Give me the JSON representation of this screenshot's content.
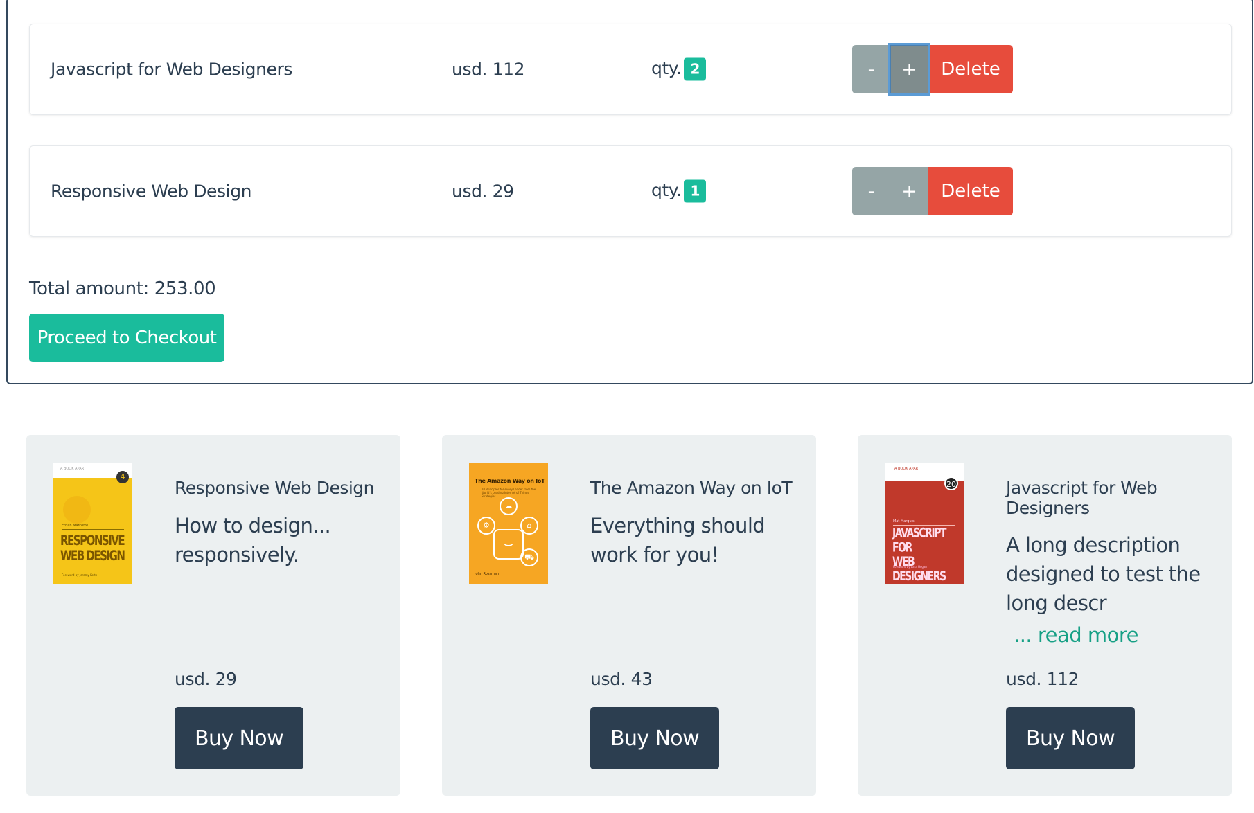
{
  "cart": {
    "items": [
      {
        "name": "Javascript for Web Designers",
        "price": "usd. 112",
        "qty_label": "qty.",
        "qty": "2"
      },
      {
        "name": "Responsive Web Design",
        "price": "usd. 29",
        "qty_label": "qty.",
        "qty": "1"
      }
    ],
    "minus_label": "-",
    "plus_label": "+",
    "delete_label": "Delete",
    "total": "Total amount: 253.00",
    "checkout_label": "Proceed to Checkout"
  },
  "products": [
    {
      "title": "Responsive Web Design",
      "description": "How to design... responsively.",
      "price": "usd. 29",
      "buy_label": "Buy Now",
      "cover": {
        "publisher": "A BOOK APART",
        "number": "4",
        "author": "Ethan Marcotte",
        "title_line1": "RESPONSIVE",
        "title_line2": "WEB DESIGN",
        "foreword": "Foreword by Jeremy Keith"
      }
    },
    {
      "title": "The Amazon Way on IoT",
      "description": "Everything should work for you!",
      "price": "usd. 43",
      "buy_label": "Buy Now",
      "cover": {
        "title": "The Amazon Way on IoT",
        "subtitle": "10 Principles for every Leader from the World's Leading Internet of Things Strategies",
        "author": "John Rossman"
      }
    },
    {
      "title": "Javascript for Web Designers",
      "description": "A long description designed to test the long descr",
      "read_more": "... read more",
      "price": "usd. 112",
      "buy_label": "Buy Now",
      "cover": {
        "publisher": "A BOOK APART",
        "number": "20",
        "author": "Mat Marquis",
        "title_line1": "JAVASCRIPT FOR",
        "title_line2": "WEB DESIGNERS",
        "foreword": "Foreword by Lara Hogan"
      }
    }
  ],
  "colors": {
    "accent": "#1abc9c",
    "danger": "#e74c3c",
    "muted": "#95a5a6",
    "dark": "#2c3e50",
    "card_bg": "#ecf0f1"
  }
}
